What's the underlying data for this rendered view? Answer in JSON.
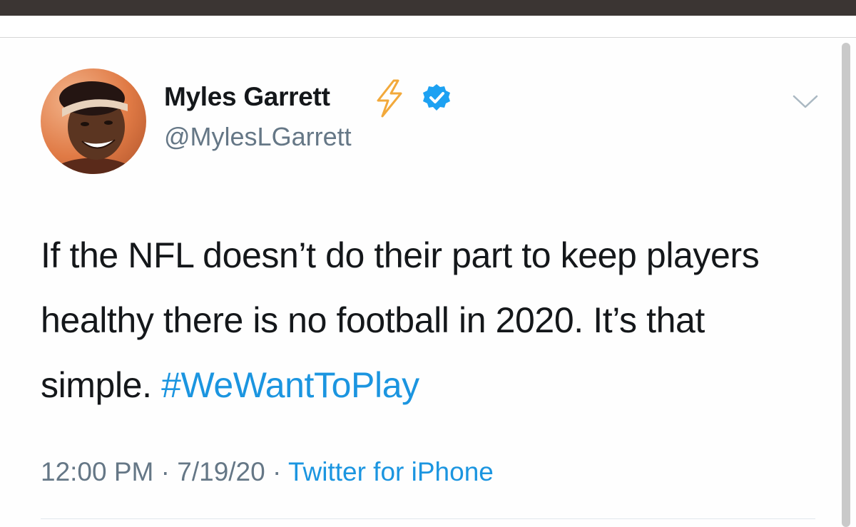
{
  "tweet": {
    "display_name": "Myles Garrett",
    "handle": "@MylesLGarrett",
    "text_parts": [
      "If the NFL doesn’t do their part to keep players healthy there is no football in 2020. It’s that simple. "
    ],
    "hashtag": "#WeWantToPlay",
    "time": "12:00 PM",
    "separator": " · ",
    "date": "7/19/20",
    "source": "Twitter for iPhone",
    "icons": {
      "name_emoji": "lightning-bolt-icon",
      "verified": "verified-badge-icon",
      "menu": "chevron-down-icon"
    },
    "colors": {
      "link": "#1b95e0",
      "secondary": "#657786",
      "verified": "#1da1f2"
    }
  }
}
